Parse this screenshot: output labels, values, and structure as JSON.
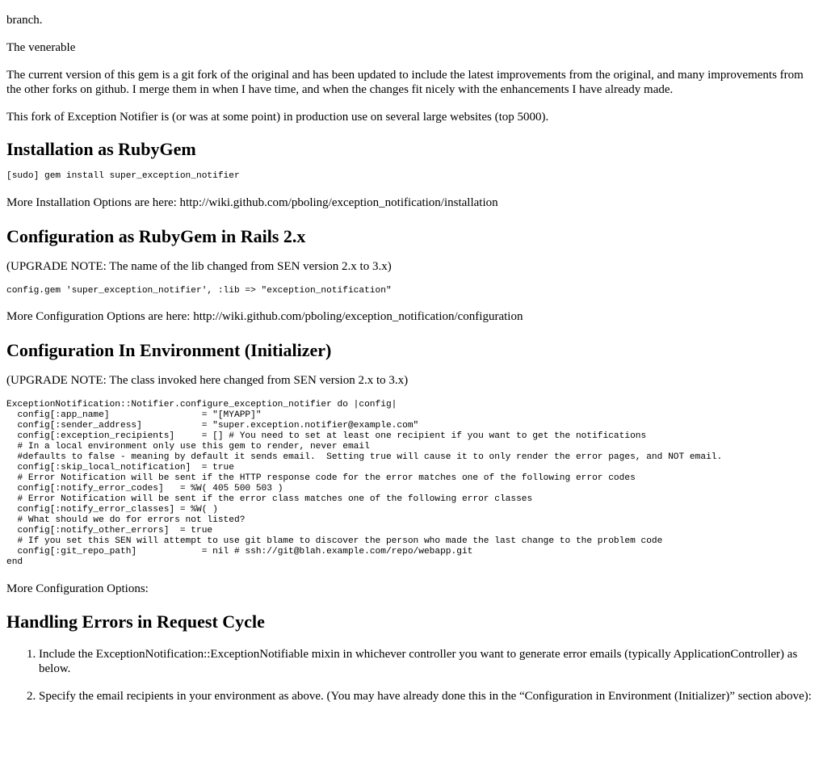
{
  "intro": {
    "branch_line": "branch.",
    "venerable_line": "The venerable",
    "current_version": "The current version of this gem is a git fork of the original and has been updated to include the latest improvements from the original, and many improvements from the other forks on github. I merge them in when I have time, and when the changes fit nicely with the enhancements I have already made.",
    "production_use": "This fork of Exception Notifier is (or was at some point) in production use on several large websites (top 5000)."
  },
  "installation": {
    "heading": "Installation as RubyGem",
    "code": "[sudo] gem install super_exception_notifier",
    "more_options": "More Installation Options are here: http://wiki.github.com/pboling/exception_notification/installation"
  },
  "configuration_gem": {
    "heading": "Configuration as RubyGem in Rails 2.x",
    "upgrade_note": "(UPGRADE NOTE: The name of the lib changed from SEN version 2.x to 3.x)",
    "code": "config.gem 'super_exception_notifier', :lib => \"exception_notification\"",
    "more_options": "More Configuration Options are here: http://wiki.github.com/pboling/exception_notification/configuration"
  },
  "configuration_env": {
    "heading": "Configuration In Environment (Initializer)",
    "upgrade_note": "(UPGRADE NOTE: The class invoked here changed from SEN version 2.x to 3.x)",
    "code": "ExceptionNotification::Notifier.configure_exception_notifier do |config|\n  config[:app_name]                 = \"[MYAPP]\"\n  config[:sender_address]           = \"super.exception.notifier@example.com\"\n  config[:exception_recipients]     = [] # You need to set at least one recipient if you want to get the notifications\n  # In a local environment only use this gem to render, never email\n  #defaults to false - meaning by default it sends email.  Setting true will cause it to only render the error pages, and NOT email.\n  config[:skip_local_notification]  = true\n  # Error Notification will be sent if the HTTP response code for the error matches one of the following error codes\n  config[:notify_error_codes]   = %W( 405 500 503 )\n  # Error Notification will be sent if the error class matches one of the following error classes\n  config[:notify_error_classes] = %W( )\n  # What should we do for errors not listed?\n  config[:notify_other_errors]  = true\n  # If you set this SEN will attempt to use git blame to discover the person who made the last change to the problem code\n  config[:git_repo_path]            = nil # ssh://git@blah.example.com/repo/webapp.git\nend",
    "more_options": "More Configuration Options:"
  },
  "handling": {
    "heading": "Handling Errors in Request Cycle",
    "steps": [
      "Include the ExceptionNotification::ExceptionNotifiable mixin in whichever controller you want to generate error emails (typically ApplicationController) as below.",
      "Specify the email recipients in your environment as above. (You may have already done this in the “Configuration in Environment (Initializer)” section above):"
    ]
  }
}
